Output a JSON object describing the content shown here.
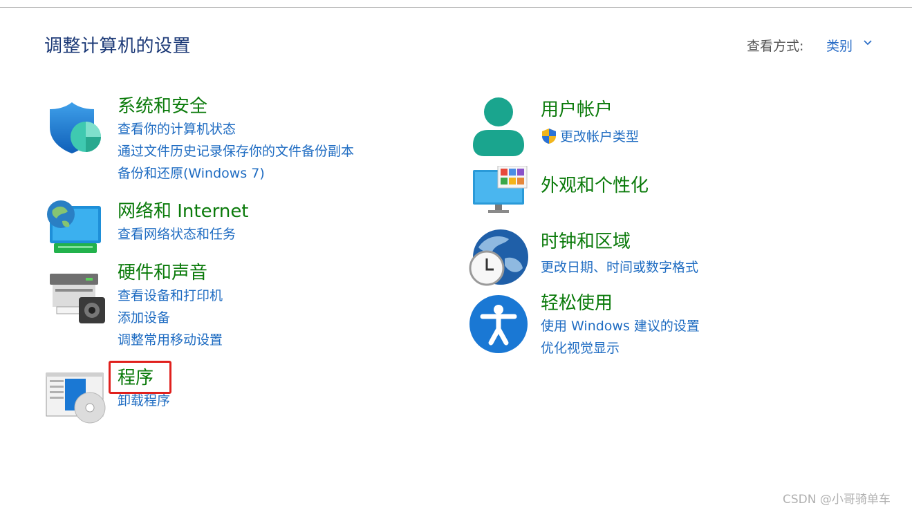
{
  "page": {
    "title": "调整计算机的设置",
    "view_by_label": "查看方式:",
    "view_by_value": "类别"
  },
  "categories": {
    "system_security": {
      "title": "系统和安全",
      "links": [
        "查看你的计算机状态",
        "通过文件历史记录保存你的文件备份副本",
        "备份和还原(Windows 7)"
      ]
    },
    "network": {
      "title": "网络和 Internet",
      "links": [
        "查看网络状态和任务"
      ]
    },
    "hardware": {
      "title": "硬件和声音",
      "links": [
        "查看设备和打印机",
        "添加设备",
        "调整常用移动设置"
      ]
    },
    "programs": {
      "title": "程序",
      "links": [
        "卸载程序"
      ]
    },
    "user_accounts": {
      "title": "用户帐户",
      "links": [
        "更改帐户类型"
      ]
    },
    "appearance": {
      "title": "外观和个性化",
      "links": []
    },
    "clock_region": {
      "title": "时钟和区域",
      "links": [
        "更改日期、时间或数字格式"
      ]
    },
    "ease_of_access": {
      "title": "轻松使用",
      "links": [
        "使用 Windows 建议的设置",
        "优化视觉显示"
      ]
    }
  },
  "watermark": "CSDN @小哥骑单车",
  "colors": {
    "category_title": "#0a7a0a",
    "link": "#1f6cc2",
    "page_title": "#1e3b78",
    "highlight": "#e0201d"
  },
  "icons": [
    "shield-icon",
    "network-icon",
    "printer-icon",
    "programs-icon",
    "user-icon",
    "uac-shield-icon",
    "appearance-icon",
    "globe-clock-icon",
    "accessibility-icon",
    "chevron-down-icon"
  ]
}
